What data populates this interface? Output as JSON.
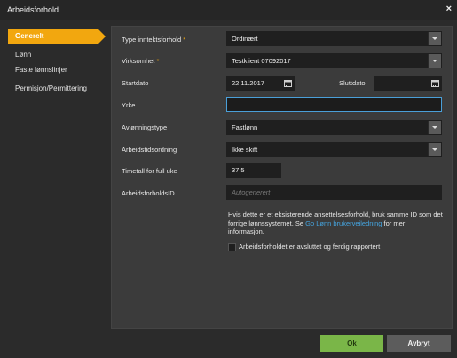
{
  "window": {
    "title": "Arbeidsforhold",
    "close_label": "×"
  },
  "sidebar": {
    "items": [
      {
        "label": "Generelt",
        "active": true
      },
      {
        "label": "Lønn"
      },
      {
        "label": "Faste lønnslinjer"
      },
      {
        "label": "Permisjon/Permittering"
      }
    ]
  },
  "form": {
    "inntektsforhold": {
      "label": "Type inntektsforhold",
      "required": "*",
      "value": "Ordinært"
    },
    "virksomhet": {
      "label": "Virksomhet",
      "required": "*",
      "value": "Testklient 07092017"
    },
    "startdato": {
      "label": "Startdato",
      "value": "22.11.2017"
    },
    "sluttdato": {
      "label": "Sluttdato",
      "value": ""
    },
    "yrke": {
      "label": "Yrke",
      "value": ""
    },
    "avlonningstype": {
      "label": "Avlønningstype",
      "value": "Fastlønn"
    },
    "arbeidstidsordning": {
      "label": "Arbeidstidsordning",
      "value": "Ikke skift"
    },
    "timetall": {
      "label": "Timetall for full uke",
      "value": "37,5"
    },
    "arbeidsforholdsid": {
      "label": "ArbeidsforholdsID",
      "placeholder": "Autogenerert"
    },
    "info_text_1": "Hvis dette er et eksisterende ansettelsesforhold, bruk samme ID som det forrige lønnssystemet. Se ",
    "info_link": "Go Lønn brukerveiledning",
    "info_text_2": " for mer informasjon.",
    "checkbox_label": "Arbeidsforholdet er avsluttet og ferdig rapportert",
    "checkbox_checked": false
  },
  "buttons": {
    "ok": "Ok",
    "cancel": "Avbryt"
  },
  "colors": {
    "accent": "#f2a70f",
    "ok": "#7ab648",
    "link": "#45a5e0",
    "focus": "#4a9fd8"
  }
}
